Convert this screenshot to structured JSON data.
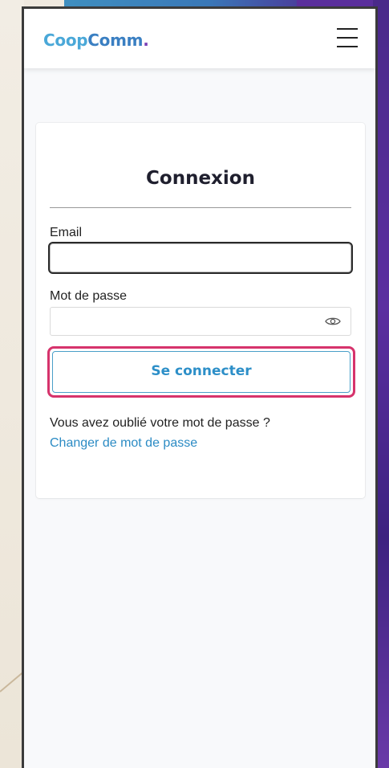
{
  "header": {
    "logo_part1": "Coop",
    "logo_part2": "Comm",
    "logo_dot": ".",
    "menu_icon": "hamburger-menu-icon"
  },
  "login": {
    "title": "Connexion",
    "email_label": "Email",
    "email_value": "",
    "password_label": "Mot de passe",
    "password_value": "",
    "password_toggle_icon": "eye-icon",
    "submit_label": "Se connecter",
    "forgot_text": "Vous avez oublié votre mot de passe ?",
    "change_password_link": "Changer de mot de passe"
  },
  "colors": {
    "logo_light_blue": "#4aa8d8",
    "logo_blue": "#3a7fc2",
    "logo_purple": "#7b3fb5",
    "button_text": "#2d8fc8",
    "link": "#2b8bc4",
    "highlight_border": "#d6336c"
  }
}
